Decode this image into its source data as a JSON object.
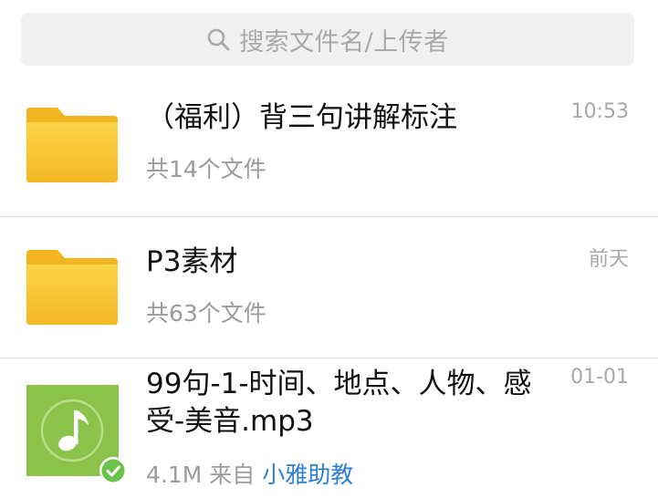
{
  "search": {
    "placeholder": "搜索文件名/上传者"
  },
  "files": [
    {
      "type": "folder",
      "icon": "folder-icon",
      "title": "（福利）背三句讲解标注",
      "meta": "共14个文件",
      "time": "10:53"
    },
    {
      "type": "folder",
      "icon": "folder-icon",
      "title": "P3素材",
      "meta": "共63个文件",
      "time": "前天"
    },
    {
      "type": "audio",
      "icon": "music-note-icon",
      "status_icon": "check-badge-icon",
      "title": "99句-1-时间、地点、人物、感受-美音.mp3",
      "size": "4.1M",
      "source_prefix": "来自",
      "source_name": "小雅助教",
      "time": "01-01"
    }
  ],
  "colors": {
    "folder": "#f7c12e",
    "audio_tile": "#8bc34a",
    "link": "#2a7fd4",
    "check": "#6cc24a"
  }
}
